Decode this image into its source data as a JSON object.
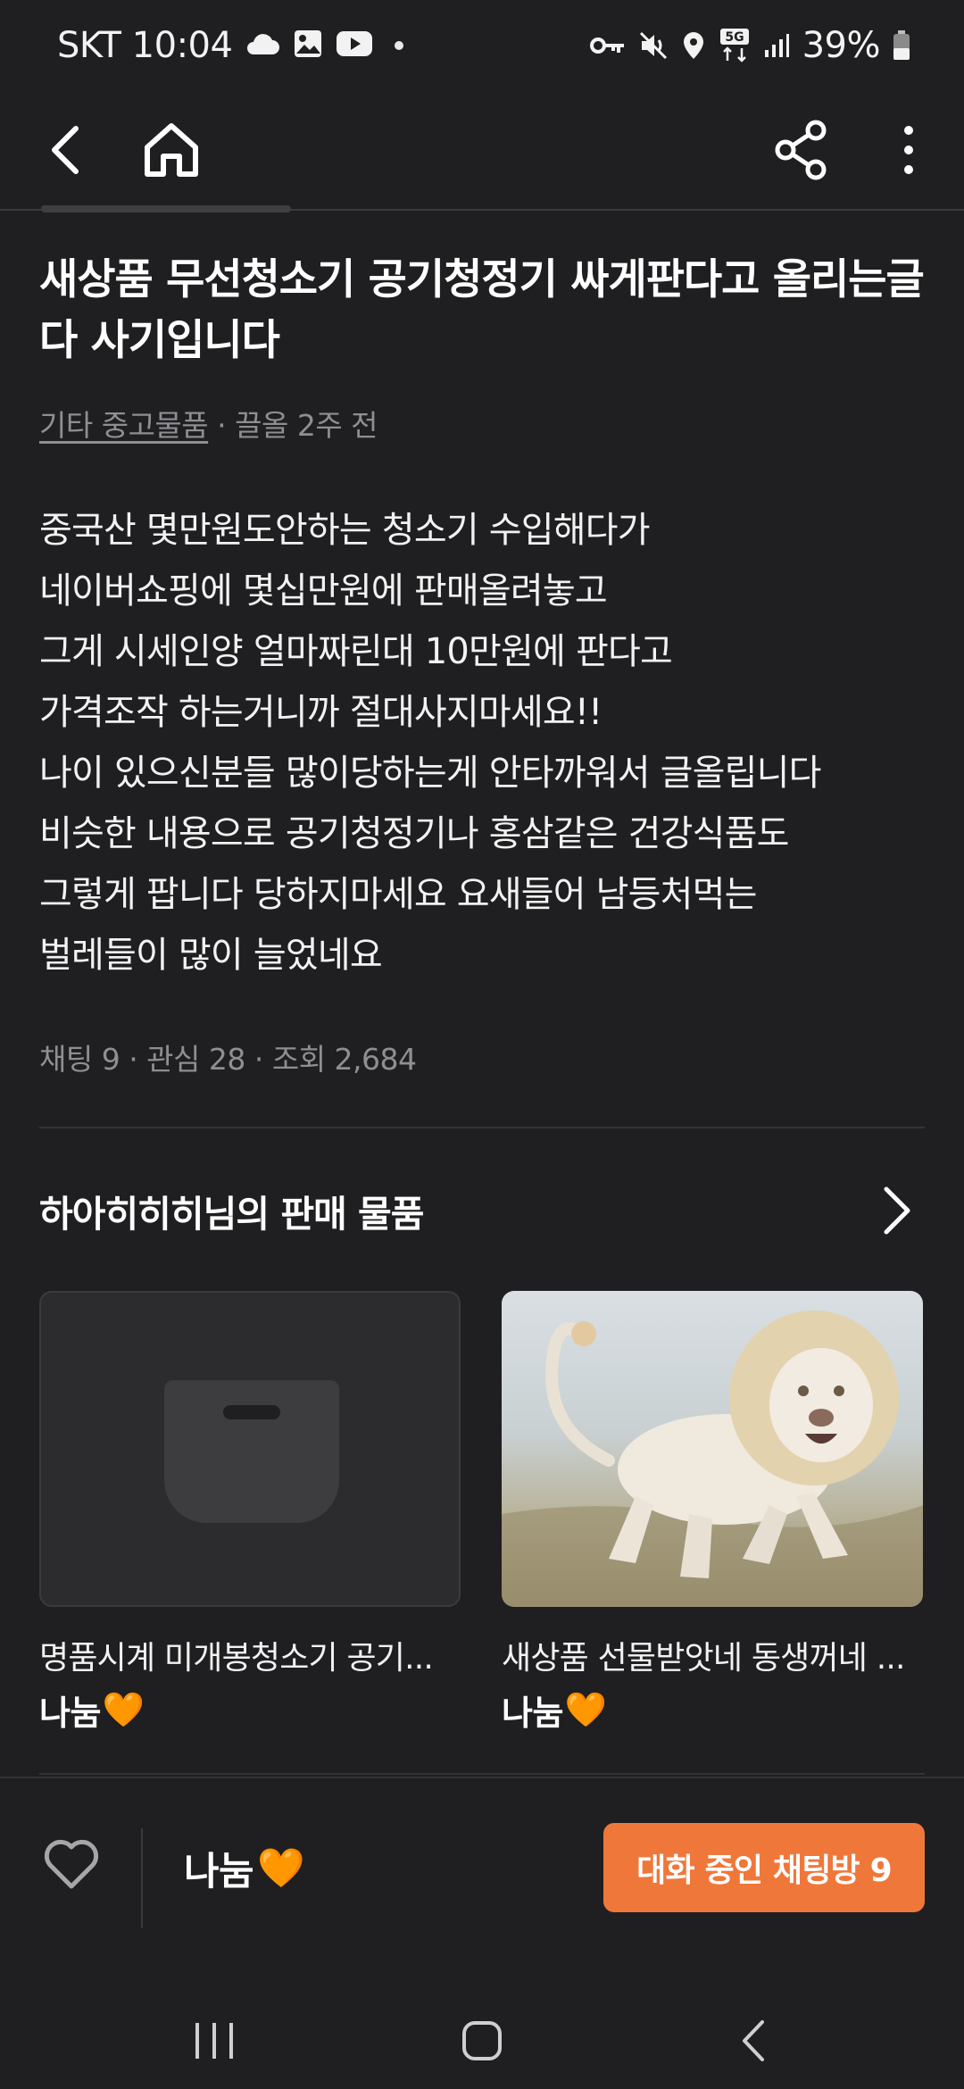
{
  "status_bar": {
    "carrier_time": "SKT 10:04",
    "network": "5G",
    "battery": "39%"
  },
  "icons": {
    "back": "chevron-left-icon",
    "home": "home-icon",
    "share": "share-icon",
    "more": "more-vertical-icon",
    "heart": "heart-outline-icon",
    "orange_heart": "🧡"
  },
  "post": {
    "title": "새상품 무선청소기 공기청정기 싸게판다고 올리는글 다 사기입니다",
    "category": "기타 중고물품",
    "meta_suffix": " · 끌올 2주 전",
    "body_lines": [
      "중국산 몇만원도안하는 청소기 수입해다가",
      "네이버쇼핑에 몇십만원에 판매올려놓고",
      "그게 시세인양 얼마짜린대 10만원에 판다고",
      "가격조작 하는거니까 절대사지마세요!!",
      "나이 있으신분들 많이당하는게 안타까워서 글올립니다",
      "비슷한 내용으로 공기청정기나 홍삼같은 건강식품도",
      "그렇게 팝니다 당하지마세요  요새들어 남등처먹는",
      "벌레들이 많이 늘었네요"
    ],
    "stats": "채팅 9 · 관심 28 · 조회 2,684"
  },
  "seller_section": {
    "title": "하아히히히님의 판매 물품",
    "items": [
      {
        "name": "명품시계 미개봉청소기 공기...",
        "price": "나눔"
      },
      {
        "name": "새상품 선물받앗네 동생꺼네 ...",
        "price": "나눔"
      }
    ]
  },
  "bottom_bar": {
    "price": "나눔",
    "chat_button": "대화 중인 채팅방 9",
    "accent_color": "#f0773a"
  }
}
